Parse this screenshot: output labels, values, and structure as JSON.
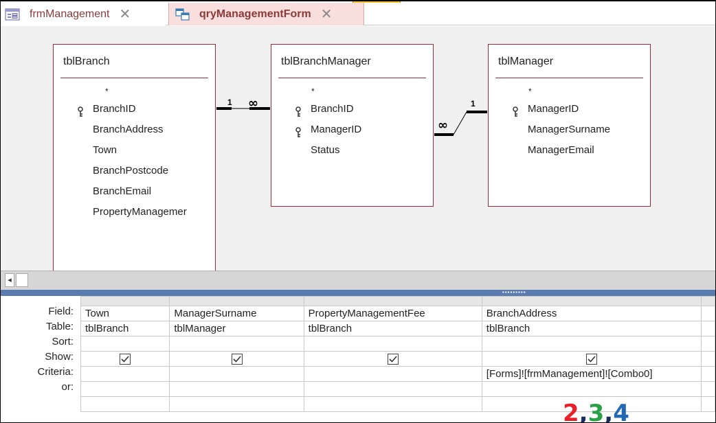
{
  "tabs": [
    {
      "label": "frmManagement",
      "icon": "form-icon"
    },
    {
      "label": "qryManagementForm",
      "icon": "query-icon"
    }
  ],
  "tables": [
    {
      "name": "tblBranch",
      "fields": [
        "*",
        "BranchID",
        "BranchAddress",
        "Town",
        "BranchPostcode",
        "BranchEmail",
        "PropertyManagemer"
      ],
      "keys": [
        "BranchID"
      ]
    },
    {
      "name": "tblBranchManager",
      "fields": [
        "*",
        "BranchID",
        "ManagerID",
        "Status"
      ],
      "keys": [
        "BranchID",
        "ManagerID"
      ]
    },
    {
      "name": "tblManager",
      "fields": [
        "*",
        "ManagerID",
        "ManagerSurname",
        "ManagerEmail"
      ],
      "keys": [
        "ManagerID"
      ]
    }
  ],
  "relationships": [
    {
      "from": "tblBranch",
      "to": "tblBranchManager",
      "from_label": "1",
      "to_label": "∞"
    },
    {
      "from": "tblBranchManager",
      "to": "tblManager",
      "from_label": "∞",
      "to_label": "1"
    }
  ],
  "grid": {
    "row_labels": [
      "Field:",
      "Table:",
      "Sort:",
      "Show:",
      "Criteria:",
      "or:"
    ],
    "columns": [
      {
        "field": "Town",
        "table": "tblBranch",
        "sort": "",
        "show": true,
        "criteria": "",
        "or": ""
      },
      {
        "field": "ManagerSurname",
        "table": "tblManager",
        "sort": "",
        "show": true,
        "criteria": "",
        "or": ""
      },
      {
        "field": "PropertyManagementFee",
        "table": "tblBranch",
        "sort": "",
        "show": true,
        "criteria": "",
        "or": ""
      },
      {
        "field": "BranchAddress",
        "table": "tblBranch",
        "sort": "",
        "show": true,
        "criteria": "[Forms]![frmManagement]![Combo0]",
        "or": ""
      }
    ]
  },
  "annotation": {
    "n1": "2",
    "sep1": ",",
    "n2": "3",
    "sep2": ",",
    "n3": "4"
  },
  "colors": {
    "table_border": "#9b2d3a",
    "accent": "#5a7bb0",
    "active_tab_bg": "#f9dede"
  }
}
